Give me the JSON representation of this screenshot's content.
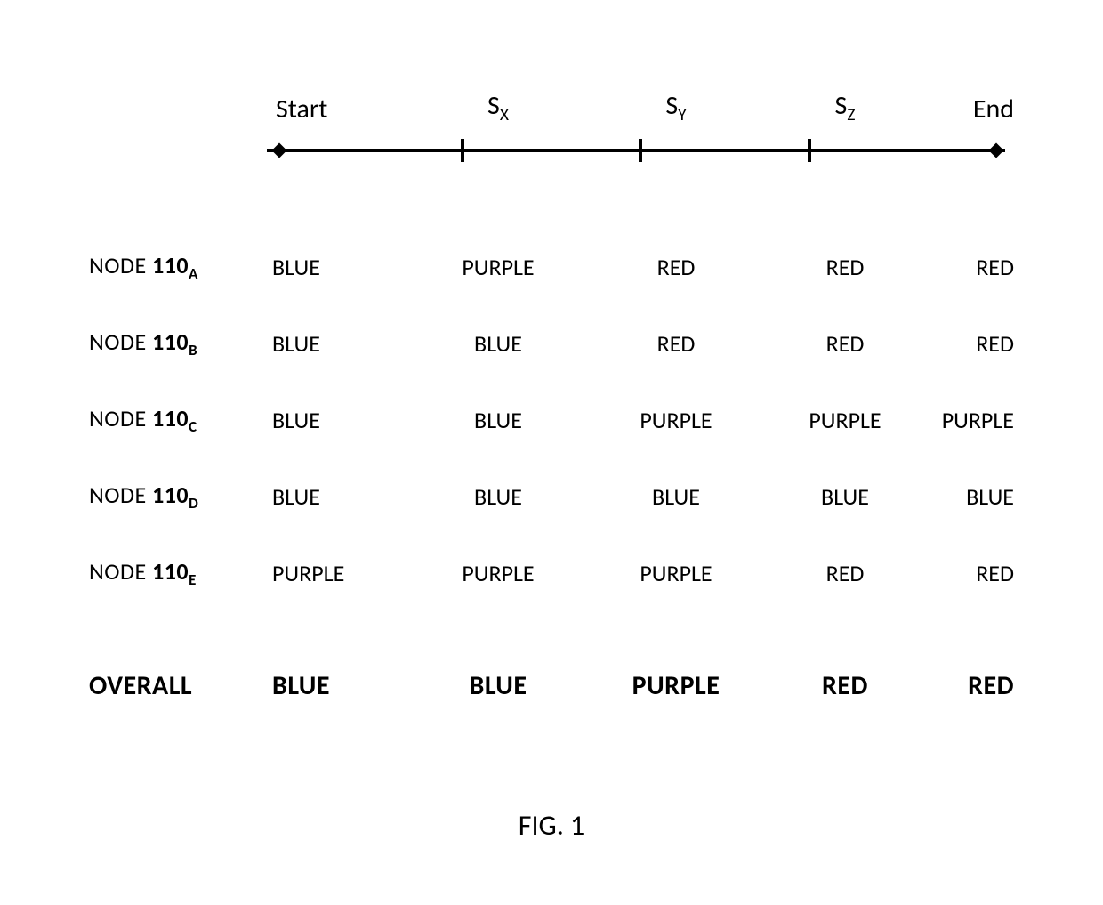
{
  "timeline": {
    "labels": [
      "Start",
      "S_X",
      "S_Y",
      "S_Z",
      "End"
    ]
  },
  "nodes": [
    {
      "name": "110",
      "sub": "A",
      "prefix": "NODE ",
      "values": [
        "BLUE",
        "PURPLE",
        "RED",
        "RED",
        "RED"
      ]
    },
    {
      "name": "110",
      "sub": "B",
      "prefix": "NODE ",
      "values": [
        "BLUE",
        "BLUE",
        "RED",
        "RED",
        "RED"
      ]
    },
    {
      "name": "110",
      "sub": "C",
      "prefix": "NODE ",
      "values": [
        "BLUE",
        "BLUE",
        "PURPLE",
        "PURPLE",
        "PURPLE"
      ]
    },
    {
      "name": "110",
      "sub": "D",
      "prefix": "NODE ",
      "values": [
        "BLUE",
        "BLUE",
        "BLUE",
        "BLUE",
        "BLUE"
      ]
    },
    {
      "name": "110",
      "sub": "E",
      "prefix": "NODE ",
      "values": [
        "PURPLE",
        "PURPLE",
        "PURPLE",
        "RED",
        "RED"
      ]
    }
  ],
  "overall": {
    "label": "OVERALL",
    "values": [
      "BLUE",
      "BLUE",
      "PURPLE",
      "RED",
      "RED"
    ]
  },
  "caption": "FIG. 1",
  "chart_data": {
    "type": "table",
    "title": "FIG. 1",
    "columns": [
      "Start",
      "S_X",
      "S_Y",
      "S_Z",
      "End"
    ],
    "rows": [
      {
        "label": "NODE 110_A",
        "values": [
          "BLUE",
          "PURPLE",
          "RED",
          "RED",
          "RED"
        ]
      },
      {
        "label": "NODE 110_B",
        "values": [
          "BLUE",
          "BLUE",
          "RED",
          "RED",
          "RED"
        ]
      },
      {
        "label": "NODE 110_C",
        "values": [
          "BLUE",
          "BLUE",
          "PURPLE",
          "PURPLE",
          "PURPLE"
        ]
      },
      {
        "label": "NODE 110_D",
        "values": [
          "BLUE",
          "BLUE",
          "BLUE",
          "BLUE",
          "BLUE"
        ]
      },
      {
        "label": "NODE 110_E",
        "values": [
          "PURPLE",
          "PURPLE",
          "PURPLE",
          "RED",
          "RED"
        ]
      },
      {
        "label": "OVERALL",
        "values": [
          "BLUE",
          "BLUE",
          "PURPLE",
          "RED",
          "RED"
        ]
      }
    ]
  }
}
